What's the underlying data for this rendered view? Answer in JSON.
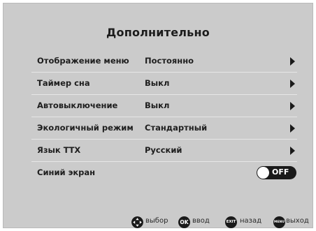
{
  "menu": {
    "title": "Дополнительно",
    "items": [
      {
        "label": "Отображение меню",
        "value": "Постоянно"
      },
      {
        "label": "Таймер сна",
        "value": "Выкл"
      },
      {
        "label": "Автовыключение",
        "value": "Выкл"
      },
      {
        "label": "Экологичный режим",
        "value": "Стандартный"
      },
      {
        "label": "Язык ТТХ",
        "value": "Русский"
      }
    ],
    "blue_screen": {
      "label": "Синий экран",
      "toggle_text": "OFF",
      "enabled": false
    }
  },
  "footer": {
    "select_label": "выбор",
    "ok_icon_text": "OK",
    "ok_label": "ввод",
    "exit_icon_text": "EXIT",
    "back_label": "назад",
    "menu_icon_text": "MENU",
    "menu_label": "выход"
  },
  "colors": {
    "background": "#cbcbcb",
    "text": "#1e1e1e",
    "accent_dark": "#1a1a1a",
    "divider": "#e6e6e6"
  },
  "icons": [
    "arrow-right-icon",
    "dpad-icon",
    "ok-button-icon",
    "exit-button-icon",
    "menu-button-icon"
  ]
}
